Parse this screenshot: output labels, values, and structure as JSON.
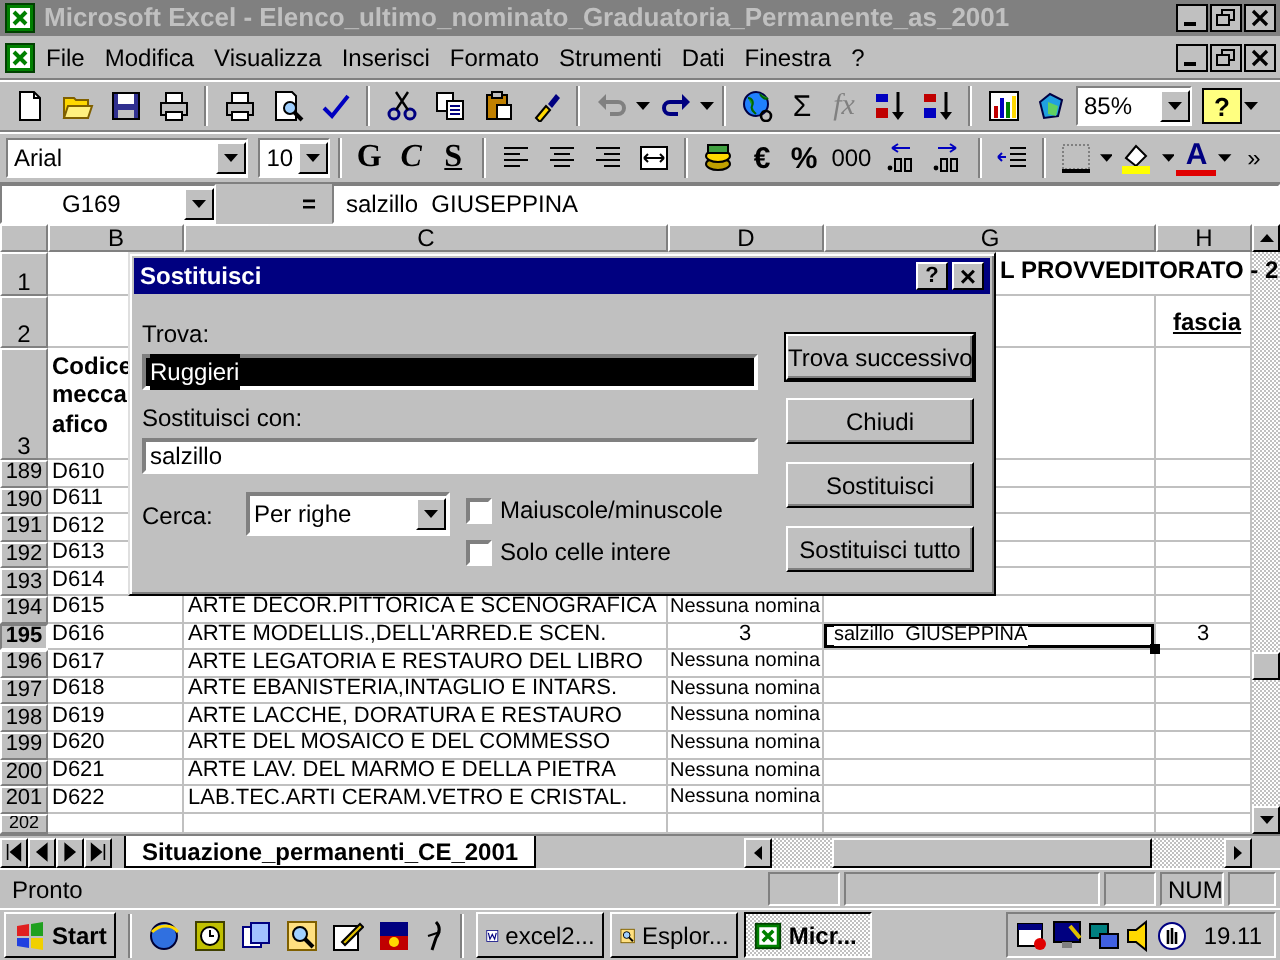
{
  "window": {
    "title": "Microsoft Excel - Elenco_ultimo_nominato_Graduatoria_Permanente_as_2001"
  },
  "menu": [
    "File",
    "Modifica",
    "Visualizza",
    "Inserisci",
    "Formato",
    "Strumenti",
    "Dati",
    "Finestra",
    "?"
  ],
  "standard_toolbar": {
    "autosum": "Σ",
    "function": "fx",
    "function_disabled": true,
    "zoom": "85%",
    "help": "?"
  },
  "formatting_toolbar": {
    "font": "Arial",
    "size": "10",
    "bold": "G",
    "italic": "C",
    "underline": "S",
    "euro": "€",
    "percent": "%",
    "thousands": "000",
    "font_color": "A",
    "more": "»"
  },
  "formula_bar": {
    "name_box": "G169",
    "equals": "=",
    "content": "salzillo  GIUSEPPINA"
  },
  "columns": [
    "B",
    "C",
    "D",
    "G",
    "H"
  ],
  "rows": [
    {
      "number": "1",
      "selected": false,
      "cells": {
        "G": {
          "text": "L PROVVEDITORATO - 2",
          "active": false
        }
      }
    },
    {
      "number": "2",
      "selected": false,
      "cells": {
        "H": {
          "text": "fascia",
          "active": false
        }
      }
    },
    {
      "number": "3",
      "selected": false,
      "cells": {
        "B": {
          "text": "Codice\nmecca\nafico",
          "active": false
        }
      }
    },
    {
      "number": "189",
      "selected": false,
      "cells": {
        "B": {
          "text": "D610",
          "active": false
        }
      }
    },
    {
      "number": "190",
      "selected": false,
      "cells": {
        "B": {
          "text": "D611",
          "active": false
        }
      }
    },
    {
      "number": "191",
      "selected": false,
      "cells": {
        "B": {
          "text": "D612",
          "active": false
        }
      }
    },
    {
      "number": "192",
      "selected": false,
      "cells": {
        "B": {
          "text": "D613",
          "active": false
        }
      }
    },
    {
      "number": "193",
      "selected": false,
      "cells": {
        "B": {
          "text": "D614",
          "active": false
        }
      }
    },
    {
      "number": "194",
      "selected": false,
      "cells": {
        "B": {
          "text": "D615",
          "active": false
        },
        "C": {
          "text": "ARTE DECOR.PITTORICA E SCENOGRAFICA",
          "active": false
        },
        "D": {
          "text": "Nessuna nomina",
          "active": false
        }
      }
    },
    {
      "number": "195",
      "selected": true,
      "cells": {
        "B": {
          "text": "D616",
          "active": false
        },
        "C": {
          "text": "ARTE MODELLIS.,DELL'ARRED.E SCEN.",
          "active": false
        },
        "D": {
          "text": "3",
          "active": false
        },
        "G": {
          "text": "salzillo  GIUSEPPINA",
          "active": true
        },
        "H": {
          "text": "3",
          "active": false
        }
      }
    },
    {
      "number": "196",
      "selected": false,
      "cells": {
        "B": {
          "text": "D617",
          "active": false
        },
        "C": {
          "text": "ARTE LEGATORIA E RESTAURO DEL LIBRO",
          "active": false
        },
        "D": {
          "text": "Nessuna nomina",
          "active": false
        }
      }
    },
    {
      "number": "197",
      "selected": false,
      "cells": {
        "B": {
          "text": "D618",
          "active": false
        },
        "C": {
          "text": "ARTE EBANISTERIA,INTAGLIO E INTARS.",
          "active": false
        },
        "D": {
          "text": "Nessuna nomina",
          "active": false
        }
      }
    },
    {
      "number": "198",
      "selected": false,
      "cells": {
        "B": {
          "text": "D619",
          "active": false
        },
        "C": {
          "text": "ARTE LACCHE, DORATURA E RESTAURO",
          "active": false
        },
        "D": {
          "text": "Nessuna nomina",
          "active": false
        }
      }
    },
    {
      "number": "199",
      "selected": false,
      "cells": {
        "B": {
          "text": "D620",
          "active": false
        },
        "C": {
          "text": "ARTE DEL MOSAICO E DEL COMMESSO",
          "active": false
        },
        "D": {
          "text": "Nessuna nomina",
          "active": false
        }
      }
    },
    {
      "number": "200",
      "selected": false,
      "cells": {
        "B": {
          "text": "D621",
          "active": false
        },
        "C": {
          "text": "ARTE LAV. DEL MARMO E DELLA PIETRA",
          "active": false
        },
        "D": {
          "text": "Nessuna nomina",
          "active": false
        }
      }
    },
    {
      "number": "201",
      "selected": false,
      "cells": {
        "B": {
          "text": "D622",
          "active": false
        },
        "C": {
          "text": "LAB.TEC.ARTI CERAM.VETRO E CRISTAL.",
          "active": false
        },
        "D": {
          "text": "Nessuna nomina",
          "active": false
        }
      }
    },
    {
      "number": "202",
      "selected": false,
      "cells": {}
    }
  ],
  "dialog": {
    "title": "Sostituisci",
    "help": "?",
    "close": "×",
    "find": {
      "label": "Trova:",
      "value": "Ruggieri",
      "selected": true
    },
    "replace": {
      "label": "Sostituisci con:",
      "value": "salzillo",
      "selected": false
    },
    "search": {
      "label": "Cerca:",
      "value": "Per righe"
    },
    "options": [
      {
        "label": "Maiuscole/minuscole",
        "checked": false
      },
      {
        "label": "Solo celle intere",
        "checked": false
      }
    ],
    "buttons": [
      {
        "label": "Trova successivo",
        "default": true
      },
      {
        "label": "Chiudi",
        "default": false
      },
      {
        "label": "Sostituisci",
        "default": false
      },
      {
        "label": "Sostituisci tutto",
        "default": false
      }
    ]
  },
  "sheet_tabs": [
    {
      "label": "Situazione_permanenti_CE_2001",
      "selected": true
    }
  ],
  "status_bar": {
    "text": "Pronto",
    "indicators": [
      "NUM"
    ]
  },
  "taskbar": {
    "start": "Start",
    "tasks": [
      {
        "label": "excel2...",
        "selected": false
      },
      {
        "label": "Esplor...",
        "selected": false
      },
      {
        "label": "Micr...",
        "selected": true
      }
    ],
    "clock": "19.11"
  }
}
